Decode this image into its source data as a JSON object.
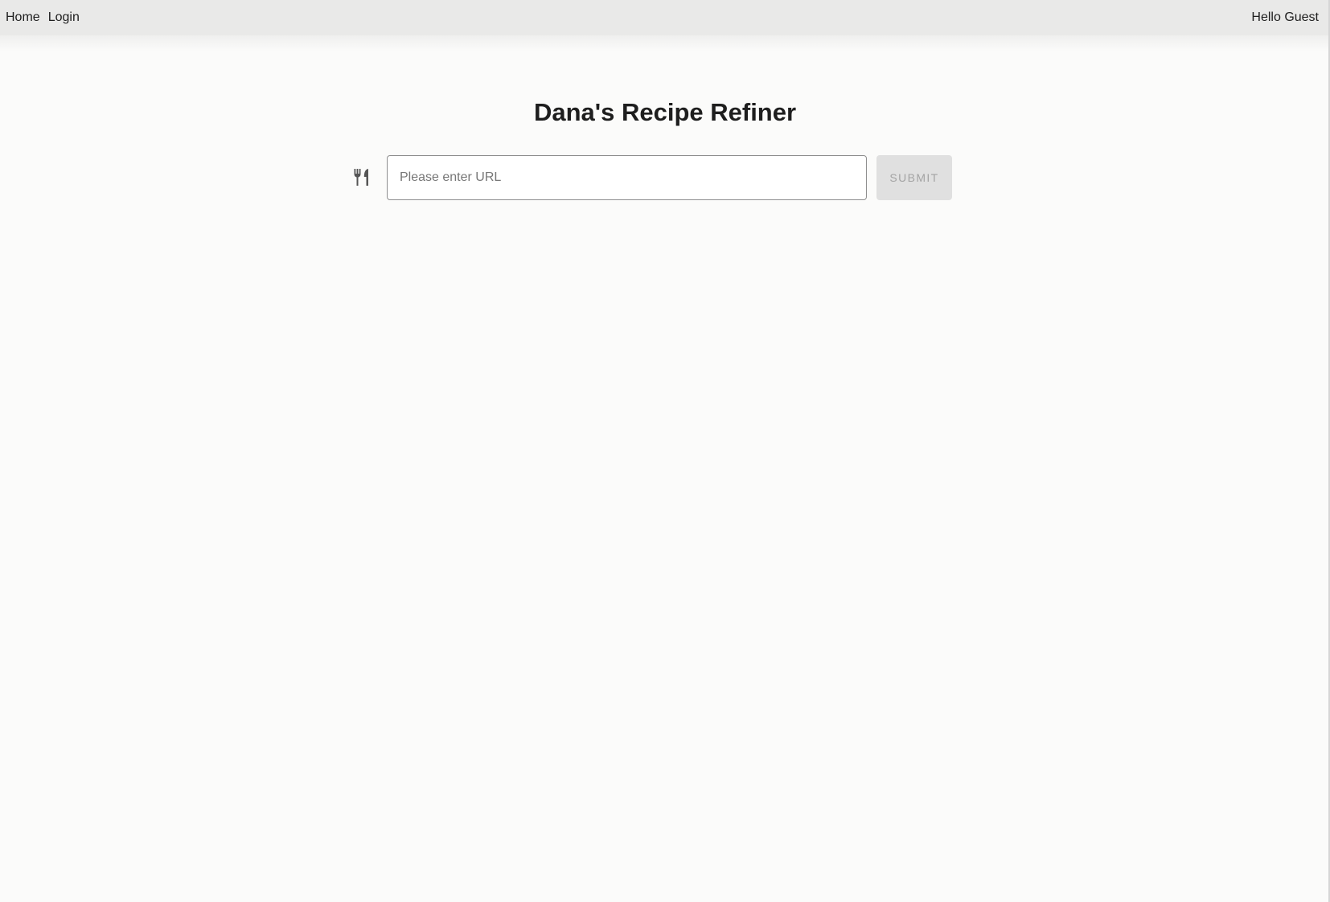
{
  "nav": {
    "links": [
      {
        "label": "Home"
      },
      {
        "label": "Login"
      }
    ],
    "greeting": "Hello Guest"
  },
  "main": {
    "title": "Dana's Recipe Refiner",
    "url_input": {
      "placeholder": "Please enter URL",
      "value": ""
    },
    "submit_label": "SUBMIT",
    "submit_disabled": true,
    "field_icon": "restaurant-icon"
  },
  "colors": {
    "navbar_bg": "#e9e9e8",
    "page_bg": "#fbfbfa",
    "text": "#1e1e1e",
    "icon": "#555555",
    "button_disabled_bg": "#e0e0e0",
    "button_disabled_text": "#a3a3a3"
  }
}
